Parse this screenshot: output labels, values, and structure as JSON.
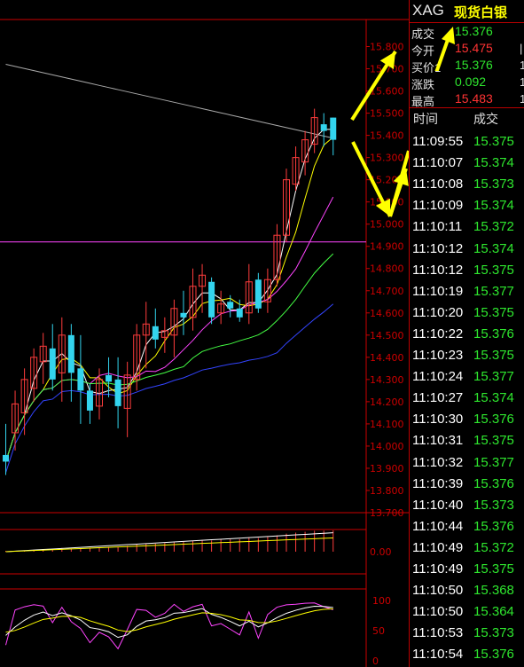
{
  "header": {
    "symbol": "XAG",
    "name": "现货白银"
  },
  "quote": [
    {
      "label": "成交",
      "value": "15.376",
      "color": "#2ee62e",
      "edge": ""
    },
    {
      "label": "今开",
      "value": "15.475",
      "color": "#ff3333",
      "edge": "|"
    },
    {
      "label": "买价1",
      "value": "15.376",
      "color": "#2ee62e",
      "edge": "1"
    },
    {
      "label": "涨跌",
      "value": "0.092",
      "color": "#2ee62e",
      "edge": "1"
    },
    {
      "label": "最高",
      "value": "15.483",
      "color": "#ff3333",
      "edge": "1"
    }
  ],
  "ticks_header": {
    "time": "时间",
    "price": "成交"
  },
  "ticks": [
    {
      "time": "11:09:55",
      "price": "15.375"
    },
    {
      "time": "11:10:07",
      "price": "15.374"
    },
    {
      "time": "11:10:08",
      "price": "15.373"
    },
    {
      "time": "11:10:09",
      "price": "15.374"
    },
    {
      "time": "11:10:11",
      "price": "15.372"
    },
    {
      "time": "11:10:12",
      "price": "15.374"
    },
    {
      "time": "11:10:12",
      "price": "15.375"
    },
    {
      "time": "11:10:19",
      "price": "15.377"
    },
    {
      "time": "11:10:20",
      "price": "15.375"
    },
    {
      "time": "11:10:22",
      "price": "15.376"
    },
    {
      "time": "11:10:23",
      "price": "15.375"
    },
    {
      "time": "11:10:24",
      "price": "15.377"
    },
    {
      "time": "11:10:27",
      "price": "15.374"
    },
    {
      "time": "11:10:30",
      "price": "15.376"
    },
    {
      "time": "11:10:31",
      "price": "15.375"
    },
    {
      "time": "11:10:32",
      "price": "15.377"
    },
    {
      "time": "11:10:39",
      "price": "15.376"
    },
    {
      "time": "11:10:40",
      "price": "15.373"
    },
    {
      "time": "11:10:44",
      "price": "15.376"
    },
    {
      "time": "11:10:49",
      "price": "15.372"
    },
    {
      "time": "11:10:49",
      "price": "15.375"
    },
    {
      "time": "11:10:50",
      "price": "15.368"
    },
    {
      "time": "11:10:50",
      "price": "15.364"
    },
    {
      "time": "11:10:53",
      "price": "15.373"
    },
    {
      "time": "11:10:54",
      "price": "15.376"
    }
  ],
  "chart_data": {
    "type": "candlestick",
    "y_ticks": [
      "15.800",
      "15.700",
      "15.600",
      "15.500",
      "15.400",
      "15.300",
      "15.200",
      "15.100",
      "15.000",
      "14.900",
      "14.800",
      "14.700",
      "14.600",
      "14.500",
      "14.400",
      "14.300",
      "14.200",
      "14.100",
      "14.000",
      "13.900",
      "13.800",
      "13.700"
    ],
    "ylim": [
      13.7,
      15.85
    ],
    "reference_line": 14.92,
    "candles": [
      {
        "o": 13.96,
        "h": 14.1,
        "l": 13.87,
        "c": 13.93
      },
      {
        "o": 14.06,
        "h": 14.25,
        "l": 13.98,
        "c": 14.19
      },
      {
        "o": 14.15,
        "h": 14.35,
        "l": 14.05,
        "c": 14.3
      },
      {
        "o": 14.26,
        "h": 14.44,
        "l": 14.2,
        "c": 14.4
      },
      {
        "o": 14.38,
        "h": 14.51,
        "l": 14.28,
        "c": 14.45
      },
      {
        "o": 14.44,
        "h": 14.55,
        "l": 14.25,
        "c": 14.3
      },
      {
        "o": 14.33,
        "h": 14.58,
        "l": 14.2,
        "c": 14.5
      },
      {
        "o": 14.5,
        "h": 14.55,
        "l": 14.2,
        "c": 14.33
      },
      {
        "o": 14.35,
        "h": 14.5,
        "l": 14.1,
        "c": 14.25
      },
      {
        "o": 14.25,
        "h": 14.28,
        "l": 14.1,
        "c": 14.16
      },
      {
        "o": 14.18,
        "h": 14.35,
        "l": 14.12,
        "c": 14.3
      },
      {
        "o": 14.32,
        "h": 14.4,
        "l": 14.22,
        "c": 14.29
      },
      {
        "o": 14.3,
        "h": 14.4,
        "l": 14.08,
        "c": 14.18
      },
      {
        "o": 14.17,
        "h": 14.38,
        "l": 14.04,
        "c": 14.32
      },
      {
        "o": 14.3,
        "h": 14.55,
        "l": 14.25,
        "c": 14.5
      },
      {
        "o": 14.5,
        "h": 14.65,
        "l": 14.35,
        "c": 14.55
      },
      {
        "o": 14.54,
        "h": 14.62,
        "l": 14.44,
        "c": 14.48
      },
      {
        "o": 14.49,
        "h": 14.58,
        "l": 14.42,
        "c": 14.52
      },
      {
        "o": 14.5,
        "h": 14.66,
        "l": 14.4,
        "c": 14.62
      },
      {
        "o": 14.6,
        "h": 14.7,
        "l": 14.5,
        "c": 14.58
      },
      {
        "o": 14.58,
        "h": 14.8,
        "l": 14.52,
        "c": 14.72
      },
      {
        "o": 14.72,
        "h": 14.82,
        "l": 14.6,
        "c": 14.77
      },
      {
        "o": 14.74,
        "h": 14.76,
        "l": 14.55,
        "c": 14.58
      },
      {
        "o": 14.6,
        "h": 14.7,
        "l": 14.55,
        "c": 14.64
      },
      {
        "o": 14.65,
        "h": 14.68,
        "l": 14.58,
        "c": 14.62
      },
      {
        "o": 14.62,
        "h": 14.66,
        "l": 14.56,
        "c": 14.58
      },
      {
        "o": 14.6,
        "h": 14.82,
        "l": 14.55,
        "c": 14.74
      },
      {
        "o": 14.75,
        "h": 14.78,
        "l": 14.6,
        "c": 14.62
      },
      {
        "o": 14.65,
        "h": 14.8,
        "l": 14.6,
        "c": 14.75
      },
      {
        "o": 14.75,
        "h": 15.0,
        "l": 14.72,
        "c": 14.95
      },
      {
        "o": 14.95,
        "h": 15.25,
        "l": 14.92,
        "c": 15.2
      },
      {
        "o": 15.18,
        "h": 15.35,
        "l": 15.15,
        "c": 15.3
      },
      {
        "o": 15.28,
        "h": 15.42,
        "l": 15.22,
        "c": 15.38
      },
      {
        "o": 15.36,
        "h": 15.52,
        "l": 15.32,
        "c": 15.48
      },
      {
        "o": 15.45,
        "h": 15.5,
        "l": 15.35,
        "c": 15.42
      },
      {
        "o": 15.48,
        "h": 15.48,
        "l": 15.31,
        "c": 15.38
      }
    ],
    "macd_ticks": [
      "0.00"
    ],
    "kdj_ticks": [
      "100",
      "50",
      "0"
    ]
  },
  "colors": {
    "up": "#ff3c3c",
    "down": "#33d4ee",
    "axis": "#cc0000",
    "ma_white": "#ffffff",
    "ma_yellow": "#ffff00",
    "ma_magenta": "#ff44ff",
    "ma_green": "#44ff44",
    "ma_blue": "#3344ff",
    "ma_gray": "#aaaaaa",
    "annotation": "#ffff00"
  }
}
